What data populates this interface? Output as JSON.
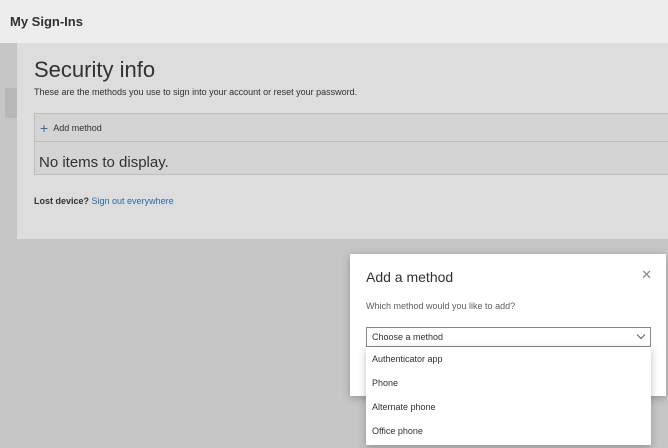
{
  "header": {
    "title": "My Sign-Ins"
  },
  "security": {
    "title": "Security info",
    "subtitle": "These are the methods you use to sign into your account or reset your password.",
    "add_method_label": "Add method",
    "empty_text": "No items to display.",
    "lost_device_label": "Lost device?",
    "sign_out_link": "Sign out everywhere"
  },
  "dialog": {
    "title": "Add a method",
    "question": "Which method would you like to add?",
    "select_value": "Choose a method",
    "options": [
      "Authenticator app",
      "Phone",
      "Alternate phone",
      "Office phone"
    ]
  },
  "colors": {
    "accent": "#2b6cb8",
    "link": "#2a68a8",
    "overlay": "#c6c6c6"
  },
  "icons": {
    "add": "plus-icon",
    "close": "close-icon",
    "dropdown": "chevron-down-icon"
  }
}
